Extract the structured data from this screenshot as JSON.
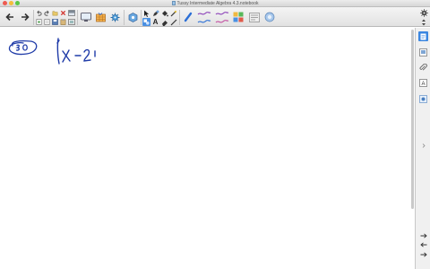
{
  "window": {
    "title": "Tussy Intermediate Algebra 4.3.notebook"
  },
  "toolbar": {
    "buttons": [
      {
        "name": "previous-page-button",
        "icon": "arrow-left-icon"
      },
      {
        "name": "next-page-button",
        "icon": "arrow-right-icon"
      },
      {
        "name": "add-page-button",
        "icon": "add-page-icon"
      },
      {
        "name": "undo-button",
        "icon": "undo-icon"
      },
      {
        "name": "redo-button",
        "icon": "redo-icon"
      },
      {
        "name": "delete-button",
        "icon": "close-icon"
      },
      {
        "name": "screen-shade-button",
        "icon": "screen-shade-icon"
      },
      {
        "name": "display-screen-button",
        "icon": "monitor-icon"
      },
      {
        "name": "table-button",
        "icon": "table-icon"
      },
      {
        "name": "lesson-activity-button",
        "icon": "lesson-icon"
      },
      {
        "name": "add-ons-button",
        "icon": "gear-icon"
      },
      {
        "name": "select-button",
        "icon": "cursor-icon"
      },
      {
        "name": "pen-button",
        "icon": "pen-icon"
      },
      {
        "name": "text-button",
        "icon": "text-icon"
      },
      {
        "name": "shapes-button",
        "icon": "shapes-icon"
      },
      {
        "name": "eraser-button",
        "icon": "eraser-icon"
      },
      {
        "name": "line-button",
        "icon": "line-icon"
      },
      {
        "name": "fill-button",
        "icon": "fill-icon"
      },
      {
        "name": "properties-button",
        "icon": "properties-icon"
      }
    ],
    "text_tool_glyph": "A"
  },
  "sidebar": {
    "tabs": [
      {
        "name": "page-sorter-tab",
        "icon": "page-sorter-icon"
      },
      {
        "name": "gallery-tab",
        "icon": "gallery-icon"
      },
      {
        "name": "attachments-tab",
        "icon": "paperclip-icon"
      },
      {
        "name": "properties-tab",
        "icon": "properties-icon"
      },
      {
        "name": "addons-tab",
        "icon": "addons-icon"
      }
    ]
  },
  "canvas": {
    "background": "#ffffff",
    "ink_color": "#1f3ba8"
  },
  "colors": {
    "accent": "#2b6fd6",
    "ink": "#1f3ba8"
  }
}
